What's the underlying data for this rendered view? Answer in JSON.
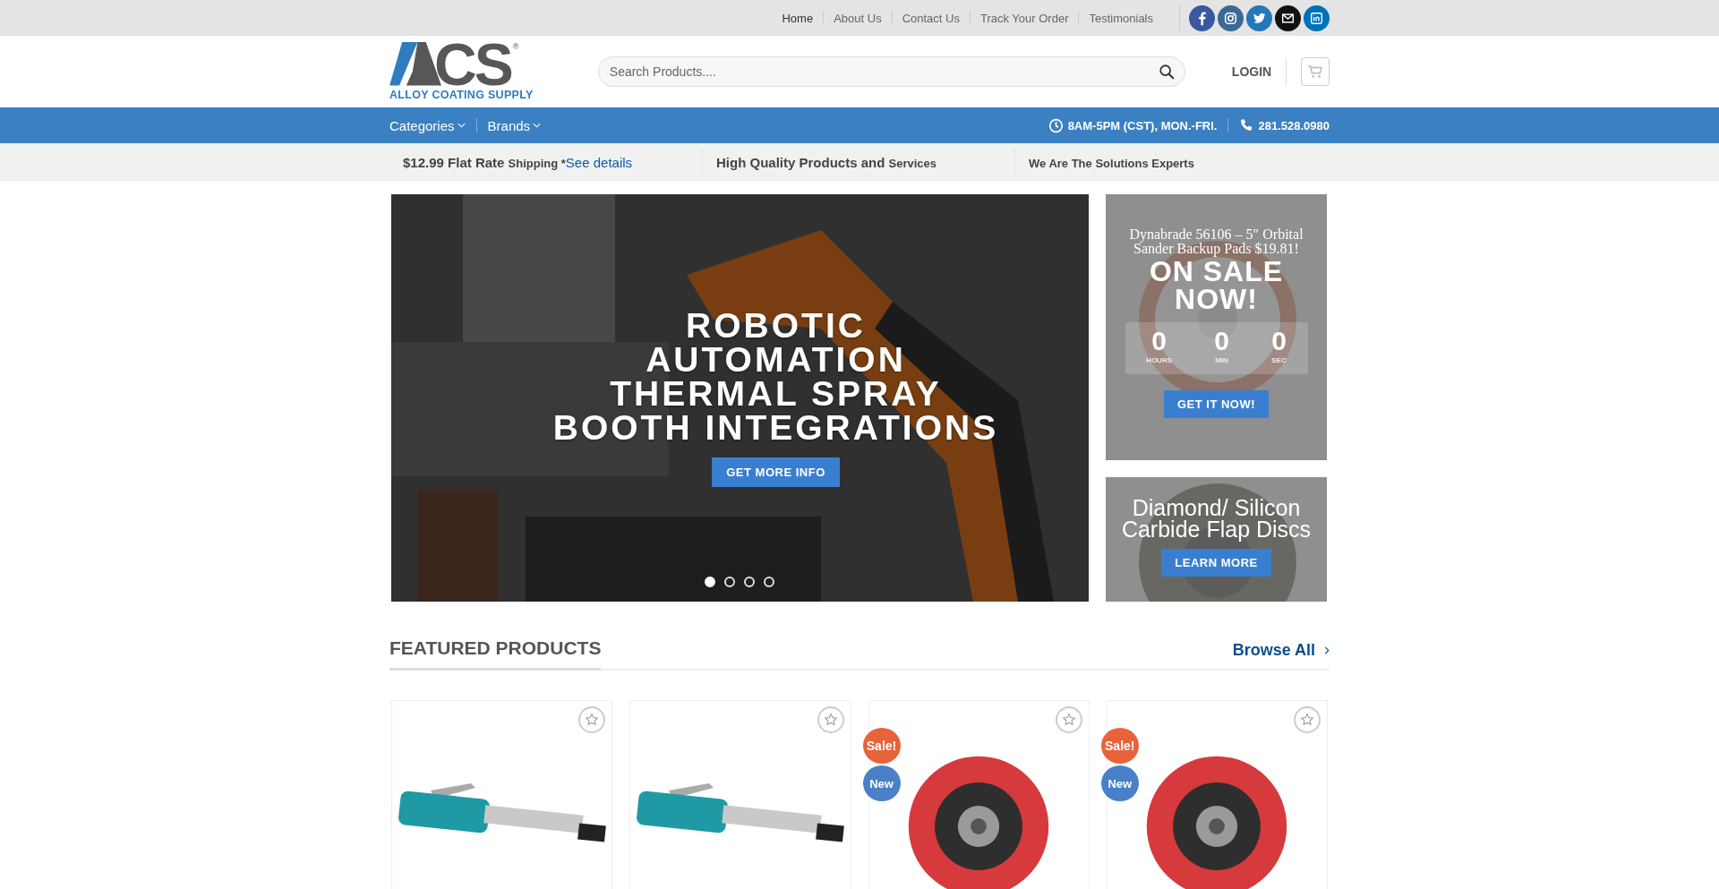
{
  "top_links": [
    {
      "label": "Home",
      "selected": true
    },
    {
      "label": "About Us",
      "selected": false
    },
    {
      "label": "Contact Us",
      "selected": false
    },
    {
      "label": "Track Your Order",
      "selected": false
    },
    {
      "label": "Testimonials",
      "selected": false
    }
  ],
  "social": [
    {
      "kind": "facebook"
    },
    {
      "kind": "instagram"
    },
    {
      "kind": "twitter"
    },
    {
      "kind": "email"
    },
    {
      "kind": "linkedin"
    }
  ],
  "logo": {
    "mark": "CS",
    "registered": "®",
    "tagline": "ALLOY COATING SUPPLY"
  },
  "search": {
    "placeholder": "Search Products...."
  },
  "login": "LOGIN",
  "main_nav": [
    {
      "label": "Categories"
    },
    {
      "label": "Brands"
    }
  ],
  "contact": {
    "hours": "8AM-5PM (CST), MON.-FRI.",
    "phone": "281.528.0980"
  },
  "promos": [
    {
      "lead": "$12.99 Flat Rate",
      "tail": "Shipping *",
      "link": "See details"
    },
    {
      "lead": "High Quality Products and",
      "tail": "Services"
    },
    {
      "tail": "We Are The Solutions Experts"
    }
  ],
  "hero": {
    "title_lines": [
      "ROBOTIC",
      "AUTOMATION",
      "THERMAL SPRAY",
      "BOOTH INTEGRATIONS"
    ],
    "button": "GET MORE INFO",
    "dots": [
      {
        "selected": true
      },
      {
        "selected": false
      },
      {
        "selected": false
      },
      {
        "selected": false
      }
    ]
  },
  "sale_panel": {
    "title": "Dynabrade 56106 – 5″ Orbital Sander Backup Pads $19.81!",
    "headline": "ON SALE NOW!",
    "countdown": [
      {
        "value": "0",
        "unit": "HOURS"
      },
      {
        "value": "0",
        "unit": "MIN"
      },
      {
        "value": "0",
        "unit": "SEC"
      }
    ],
    "button": "GET IT NOW!"
  },
  "disc_panel": {
    "title": "Diamond/ Silicon Carbide Flap Discs",
    "button": "LEARN MORE"
  },
  "featured": {
    "title": "FEATURED PRODUCTS",
    "browse": "Browse All"
  },
  "products": [
    {
      "kind": "grinder"
    },
    {
      "kind": "grinder"
    },
    {
      "kind": "flap-disc",
      "badges": [
        {
          "kind": "sale",
          "text": "Sale!"
        },
        {
          "kind": "new",
          "text": "New"
        }
      ]
    },
    {
      "kind": "flap-disc",
      "badges": [
        {
          "kind": "sale",
          "text": "Sale!"
        },
        {
          "kind": "new",
          "text": "New"
        }
      ]
    }
  ]
}
